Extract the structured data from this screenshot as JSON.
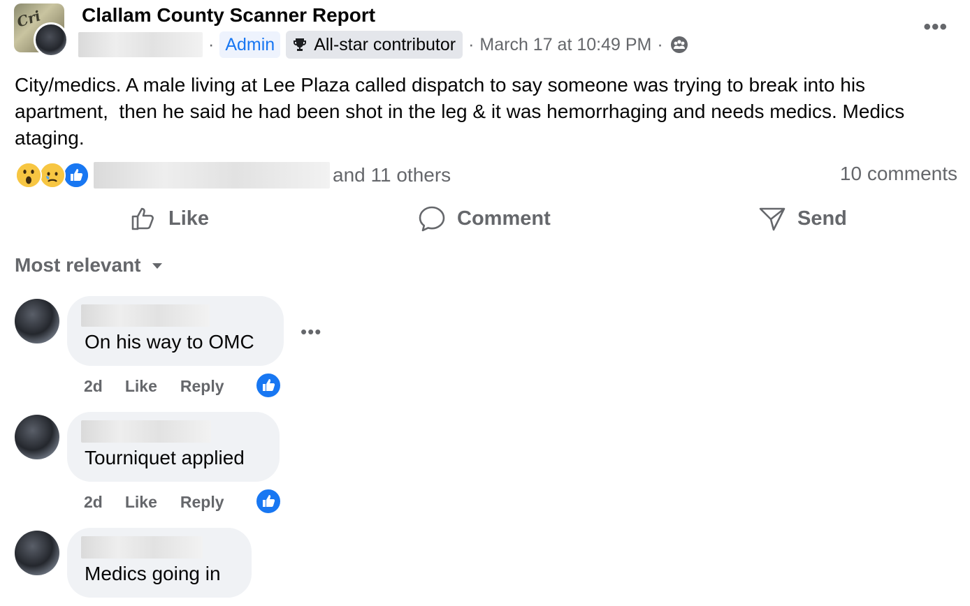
{
  "post": {
    "group_name": "Clallam County Scanner Report",
    "badges": {
      "admin": "Admin",
      "contributor": "All-star contributor"
    },
    "separator": "·",
    "timestamp": "March 17 at 10:49 PM",
    "group_avatar_text": "Cri",
    "body": "City/medics. A male living at Lee Plaza called dispatch to say someone was trying to break into his apartment,  then he said he had been shot in the leg & it was hemorrhaging and needs medics. Medics ataging.",
    "reactions": {
      "types": [
        "wow",
        "sad",
        "like"
      ],
      "others_text": "and 11 others"
    },
    "comment_count": "10 comments",
    "actions": {
      "like": "Like",
      "comment": "Comment",
      "send": "Send"
    }
  },
  "comments_section": {
    "sort_label": "Most relevant",
    "comments": [
      {
        "text": "On his way to OMC",
        "time": "2d",
        "like": "Like",
        "reply": "Reply",
        "reaction": "like"
      },
      {
        "text": "Tourniquet applied",
        "time": "2d",
        "like": "Like",
        "reply": "Reply",
        "reaction": "like"
      },
      {
        "text": "Medics going in",
        "time": "",
        "like": "",
        "reply": "",
        "reaction": ""
      }
    ]
  },
  "colors": {
    "accent": "#1877f2",
    "secondary_text": "#65676b",
    "bubble": "#f0f2f5"
  }
}
